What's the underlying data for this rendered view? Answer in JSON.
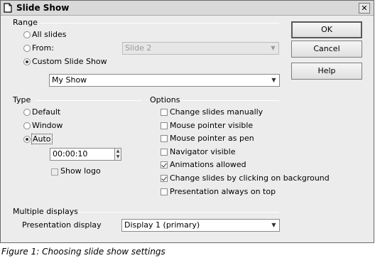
{
  "window": {
    "title": "Slide Show"
  },
  "range": {
    "label": "Range",
    "all_slides": "All slides",
    "from": "From:",
    "from_value": "Slide 2",
    "custom": "Custom Slide Show",
    "custom_value": "My Show",
    "selected": "custom"
  },
  "type": {
    "label": "Type",
    "default": "Default",
    "window": "Window",
    "auto": "Auto",
    "selected": "auto",
    "pause_value": "00:00:10",
    "show_logo": "Show logo",
    "show_logo_checked": false
  },
  "options": {
    "label": "Options",
    "items": [
      {
        "label": "Change slides manually",
        "checked": false
      },
      {
        "label": "Mouse pointer visible",
        "checked": false
      },
      {
        "label": "Mouse pointer as pen",
        "checked": false
      },
      {
        "label": "Navigator visible",
        "checked": false
      },
      {
        "label": "Animations allowed",
        "checked": true
      },
      {
        "label": "Change slides by clicking on background",
        "checked": true
      },
      {
        "label": "Presentation always on top",
        "checked": false
      }
    ]
  },
  "multiple_displays": {
    "label": "Multiple displays",
    "presentation_display": "Presentation display",
    "display_value": "Display 1 (primary)"
  },
  "buttons": {
    "ok": "OK",
    "cancel": "Cancel",
    "help": "Help"
  },
  "caption": "Figure 1: Choosing slide show settings"
}
